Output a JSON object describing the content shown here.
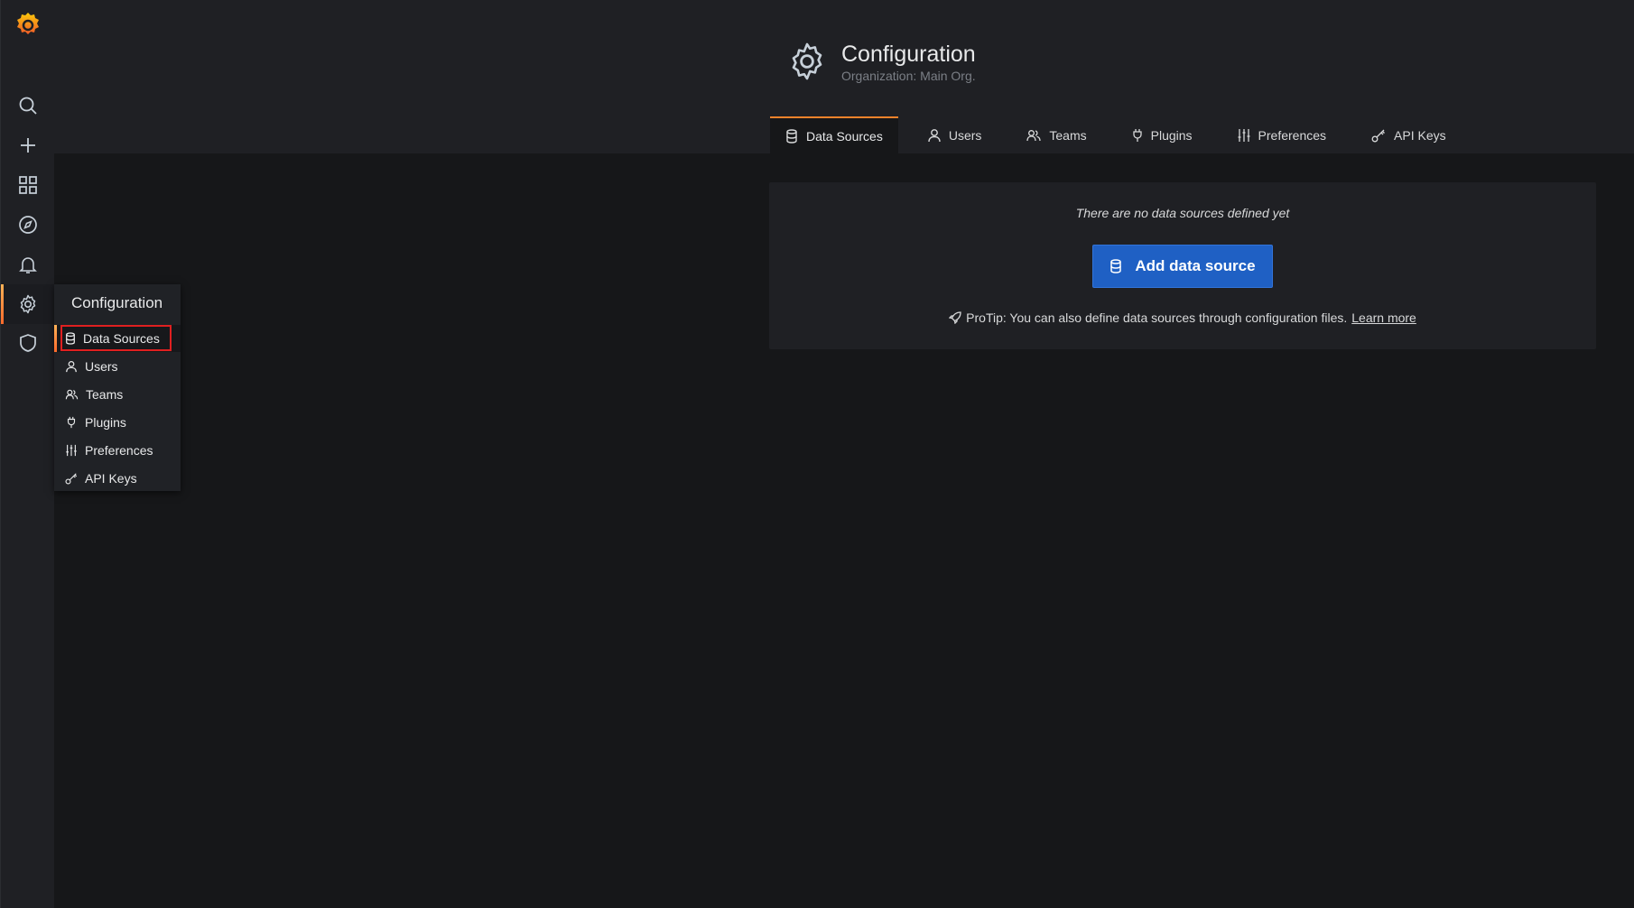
{
  "header": {
    "title": "Configuration",
    "subtitle": "Organization: Main Org."
  },
  "tabs": [
    {
      "label": "Data Sources",
      "icon": "database-icon",
      "active": true
    },
    {
      "label": "Users",
      "icon": "user-icon"
    },
    {
      "label": "Teams",
      "icon": "users-icon"
    },
    {
      "label": "Plugins",
      "icon": "plug-icon"
    },
    {
      "label": "Preferences",
      "icon": "sliders-icon"
    },
    {
      "label": "API Keys",
      "icon": "key-icon"
    }
  ],
  "empty_state": {
    "message": "There are no data sources defined yet",
    "button_label": "Add data source",
    "protip": "ProTip: You can also define data sources through configuration files.",
    "learn_more": "Learn more"
  },
  "sidebar": {
    "icons": [
      "grafana-logo",
      "search-icon",
      "plus-icon",
      "dashboards-icon",
      "explore-icon",
      "alerting-icon",
      "gear-icon",
      "shield-icon"
    ],
    "active": "gear-icon"
  },
  "flyout": {
    "title": "Configuration",
    "items": [
      {
        "label": "Data Sources",
        "icon": "database-icon",
        "active": true
      },
      {
        "label": "Users",
        "icon": "user-icon"
      },
      {
        "label": "Teams",
        "icon": "users-icon"
      },
      {
        "label": "Plugins",
        "icon": "plug-icon"
      },
      {
        "label": "Preferences",
        "icon": "sliders-icon"
      },
      {
        "label": "API Keys",
        "icon": "key-icon"
      }
    ]
  },
  "colors": {
    "accent": "#f5832b",
    "primary_button": "#1f60c4",
    "highlight": "#e02020"
  }
}
